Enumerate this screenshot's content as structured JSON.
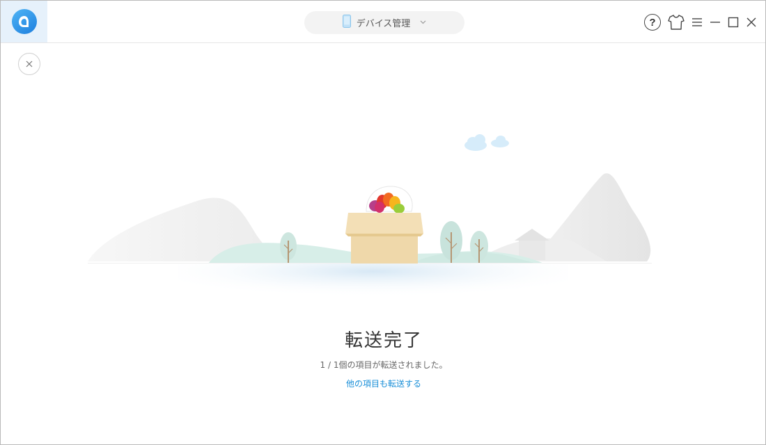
{
  "header": {
    "device_selector": {
      "label": "デバイス管理"
    }
  },
  "result": {
    "title": "転送完了",
    "summary": "1 / 1個の項目が転送されました。",
    "more_link": "他の項目も転送する"
  },
  "icons": {
    "app_logo": "app-logo-icon",
    "device": "phone-icon",
    "dropdown": "chevron-down-icon",
    "help": "help-icon",
    "skin": "tshirt-icon",
    "menu": "menu-icon",
    "minimize": "minimize-icon",
    "maximize": "maximize-icon",
    "close": "close-icon",
    "dismiss": "dismiss-close-icon"
  },
  "colors": {
    "accent": "#1a8fd8",
    "logo_bg": "#e6f1fb"
  }
}
